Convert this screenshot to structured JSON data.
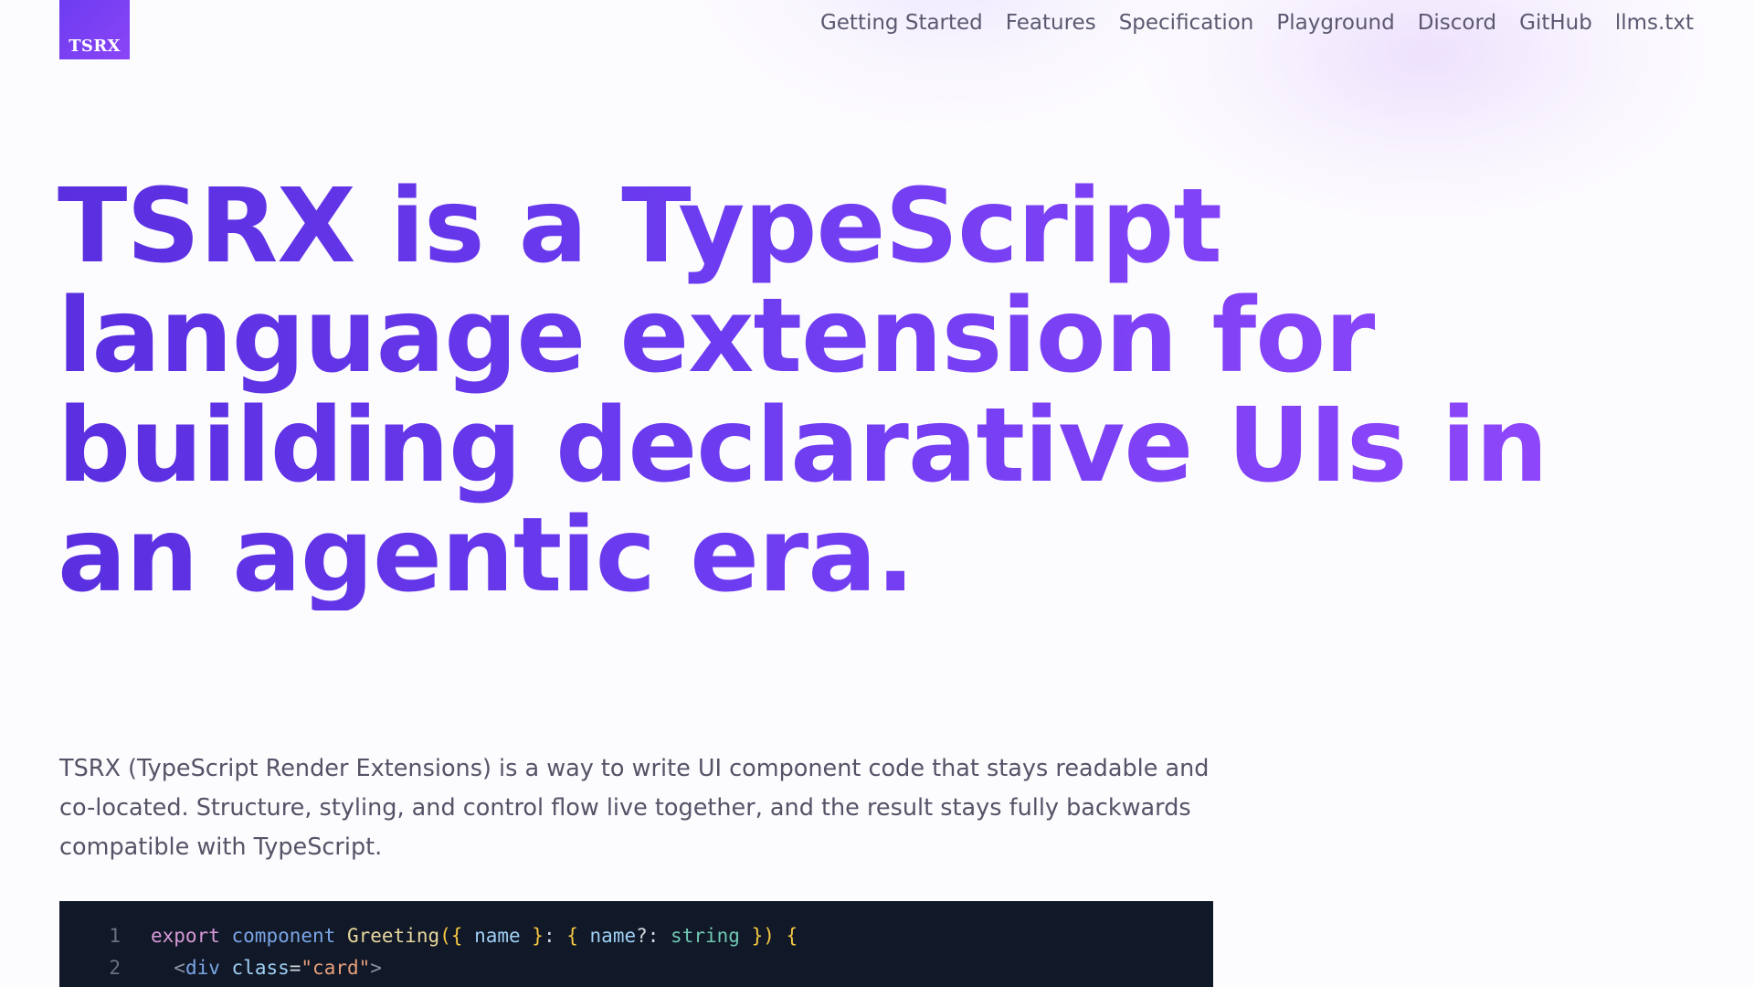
{
  "brand": {
    "logo_text": "TSRX"
  },
  "nav": {
    "items": [
      {
        "label": "Getting Started"
      },
      {
        "label": "Features"
      },
      {
        "label": "Specification"
      },
      {
        "label": "Playground"
      },
      {
        "label": "Discord"
      },
      {
        "label": "GitHub"
      },
      {
        "label": "llms.txt"
      }
    ]
  },
  "hero": {
    "title": "TSRX is a TypeScript language extension for building declarative UIs in an agentic era.",
    "description": "TSRX (TypeScript Render Extensions) is a way to write UI component code that stays readable and co-located. Structure, styling, and control flow live together, and the result stays fully backwards compatible with TypeScript."
  },
  "code": {
    "lines": [
      {
        "number": "1",
        "tokens": [
          {
            "t": "export",
            "k": "kw"
          },
          {
            "t": " ",
            "k": "punc"
          },
          {
            "t": "component",
            "k": "decl"
          },
          {
            "t": " ",
            "k": "punc"
          },
          {
            "t": "Greeting",
            "k": "fn"
          },
          {
            "t": "({",
            "k": "brace"
          },
          {
            "t": " name ",
            "k": "prop"
          },
          {
            "t": "}",
            "k": "brace"
          },
          {
            "t": ": ",
            "k": "punc"
          },
          {
            "t": "{",
            "k": "brace"
          },
          {
            "t": " name",
            "k": "prop"
          },
          {
            "t": "?: ",
            "k": "punc"
          },
          {
            "t": "string",
            "k": "type"
          },
          {
            "t": " ",
            "k": "punc"
          },
          {
            "t": "})",
            "k": "brace"
          },
          {
            "t": " ",
            "k": "punc"
          },
          {
            "t": "{",
            "k": "brace"
          }
        ]
      },
      {
        "number": "2",
        "tokens": [
          {
            "t": "  <",
            "k": "angle"
          },
          {
            "t": "div",
            "k": "tag"
          },
          {
            "t": " ",
            "k": "punc"
          },
          {
            "t": "class",
            "k": "attr"
          },
          {
            "t": "=",
            "k": "punc"
          },
          {
            "t": "\"card\"",
            "k": "str"
          },
          {
            "t": ">",
            "k": "angle"
          }
        ]
      }
    ]
  },
  "colors": {
    "brand_purple": "#6d3cf0",
    "heading_gradient_end": "#8e46fa",
    "code_background": "#111827",
    "body_text": "#565367",
    "nav_text": "#5b5870"
  }
}
